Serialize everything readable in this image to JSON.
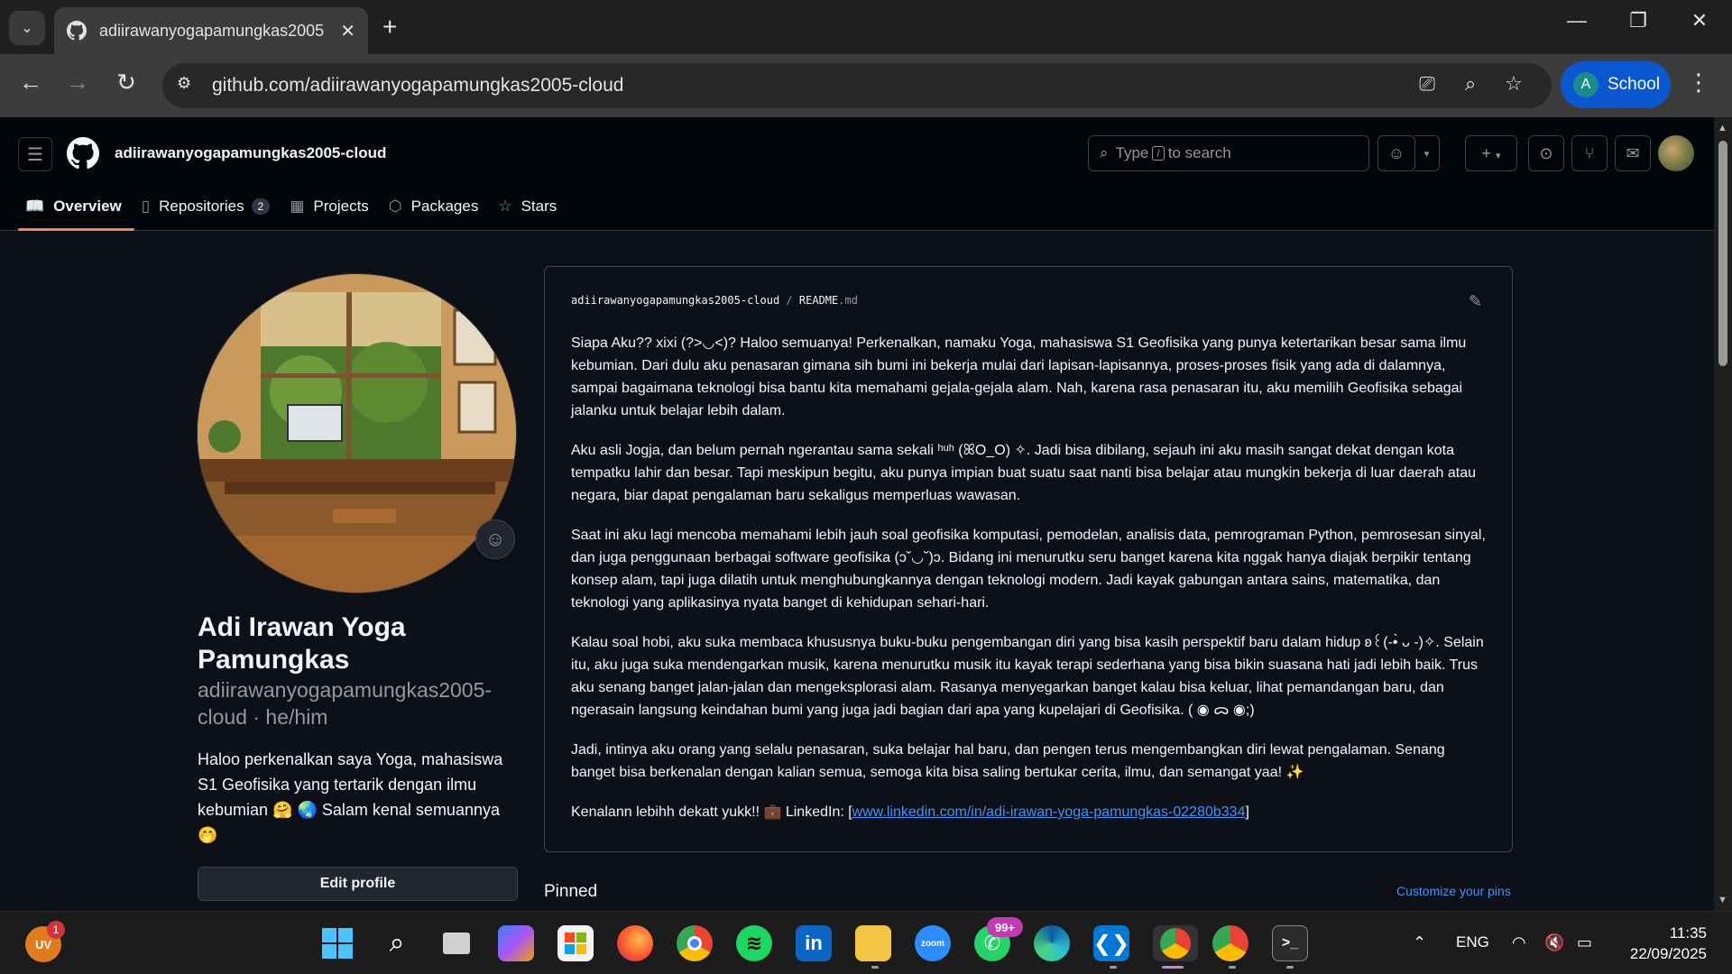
{
  "browser": {
    "tab_title": "adiirawanyogapamungkas2005",
    "url": "github.com/adiirawanyogapamungkas2005-cloud",
    "profile_initial": "A",
    "profile_label": "School"
  },
  "github": {
    "username": "adiirawanyogapamungkas2005-cloud",
    "search_prefix": "Type",
    "search_slash": "/",
    "search_suffix": "to search",
    "tabs": [
      {
        "label": "Overview",
        "icon": "book-icon"
      },
      {
        "label": "Repositories",
        "icon": "repo-icon",
        "count": "2"
      },
      {
        "label": "Projects",
        "icon": "table-icon"
      },
      {
        "label": "Packages",
        "icon": "package-icon"
      },
      {
        "label": "Stars",
        "icon": "star-icon"
      }
    ]
  },
  "profile": {
    "name": "Adi Irawan Yoga Pamungkas",
    "login_line": "adiirawanyogapamungkas2005-cloud · he/him",
    "bio": "Haloo perkenalkan saya Yoga, mahasiswa S1 Geofisika yang tertarik dengan ilmu kebumian 🤗 🌏 Salam kenal semuannya 🤭",
    "edit_label": "Edit profile"
  },
  "readme": {
    "path_owner": "adiirawanyogapamungkas2005-cloud",
    "path_sep": "/",
    "path_file": "README",
    "path_ext": ".md",
    "paragraphs": [
      "Siapa Aku?? xixi (?>◡<)? Haloo semuanya! Perkenalkan, namaku Yoga, mahasiswa S1 Geofisika yang punya ketertarikan besar sama ilmu kebumian. Dari dulu aku penasaran gimana sih bumi ini bekerja mulai dari lapisan-lapisannya, proses-proses fisik yang ada di dalamnya, sampai bagaimana teknologi bisa bantu kita memahami gejala-gejala alam. Nah, karena rasa penasaran itu, aku memilih Geofisika sebagai jalanku untuk belajar lebih dalam.",
      "Aku asli Jogja, dan belum pernah ngerantau sama sekali ʰᵘʰ (ꕤO_O) ✧. Jadi bisa dibilang, sejauh ini aku masih sangat dekat dengan kota tempatku lahir dan besar. Tapi meskipun begitu, aku punya impian buat suatu saat nanti bisa belajar atau mungkin bekerja di luar daerah atau negara, biar dapat pengalaman baru sekaligus memperluas wawasan.",
      "Saat ini aku lagi mencoba memahami lebih jauh soal geofisika komputasi, pemodelan, analisis data, pemrograman Python, pemrosesan sinyal, dan juga penggunaan berbagai software geofisika (ↄ˘◡˘)ↄ. Bidang ini menurutku seru banget karena kita nggak hanya diajak berpikir tentang konsep alam, tapi juga dilatih untuk menghubungkannya dengan teknologi modern. Jadi kayak gabungan antara sains, matematika, dan teknologi yang aplikasinya nyata banget di kehidupan sehari-hari.",
      "Kalau soal hobi, aku suka membaca khususnya buku-buku pengembangan diri yang bisa kasih perspektif baru dalam hidup ʚ꒰(-•̀ ᴗ -)✧. Selain itu, aku juga suka mendengarkan musik, karena menurutku musik itu kayak terapi sederhana yang bisa bikin suasana hati jadi lebih baik. Trus aku senang banget jalan-jalan dan mengeksplorasi alam. Rasanya menyegarkan banget kalau bisa keluar, lihat pemandangan baru, dan ngerasain langsung keindahan bumi yang juga jadi bagian dari apa yang kupelajari di Geofisika. ( ◉ ᯅ ◉;)",
      "Jadi, intinya aku orang yang selalu penasaran, suka belajar hal baru, dan pengen terus mengembangkan diri lewat pengalaman. Senang banget bisa berkenalan dengan kalian semua, semoga kita bisa saling bertukar cerita, ilmu, dan semangat yaa! ✨"
    ],
    "linkedin_prefix": "Kenalann lebihh dekatt yukk!! 💼 LinkedIn: [",
    "linkedin_url": "www.linkedin.com/in/adi-irawan-yoga-pamungkas-02280b334",
    "linkedin_suffix": "]"
  },
  "pinned": {
    "label": "Pinned",
    "customize": "Customize your pins"
  },
  "taskbar": {
    "weather_badge": "1",
    "weather_label": "UV",
    "whatsapp_badge": "99+",
    "lang": "ENG",
    "time": "11:35",
    "date": "22/09/2025"
  },
  "colors": {
    "accent_tab_underline": "#f78166",
    "link": "#4493f8",
    "chrome_profile": "#0b57d0"
  }
}
